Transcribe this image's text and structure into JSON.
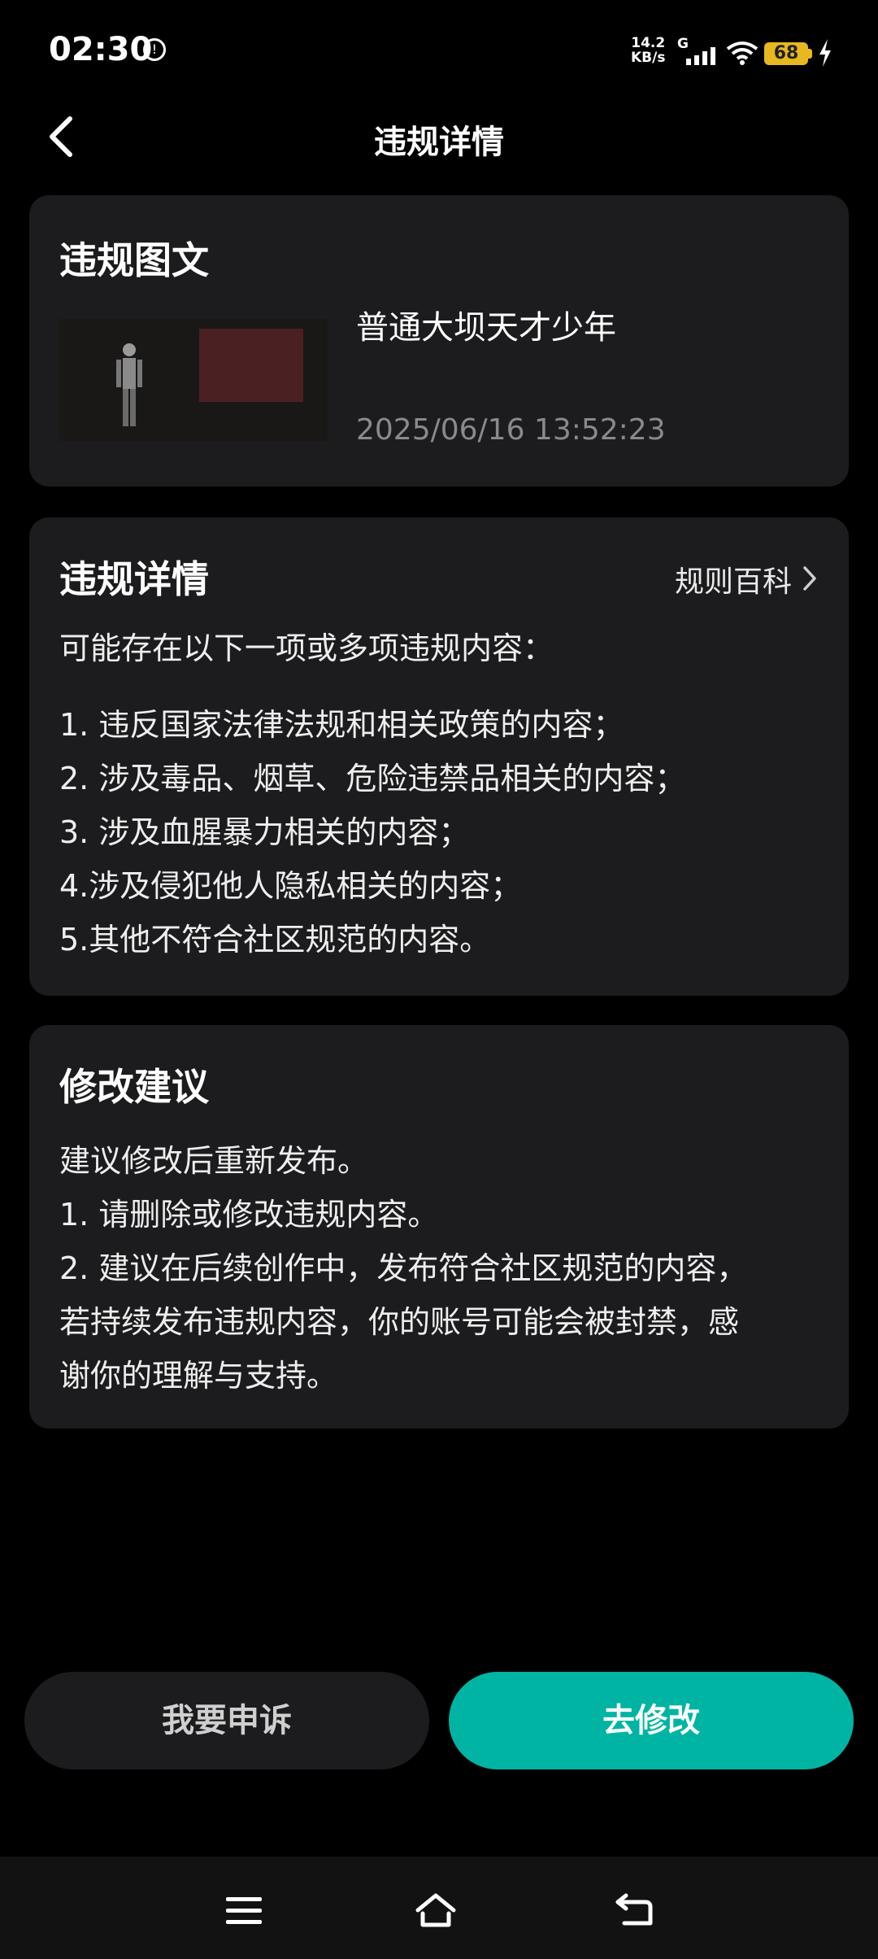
{
  "status_bar": {
    "time": "02:30",
    "net_speed_value": "14.2",
    "net_speed_unit": "KB/s",
    "network_type": "G",
    "battery": "68"
  },
  "header": {
    "title": "违规详情"
  },
  "content_card": {
    "heading": "违规图文",
    "post_title": "普通大坝天才少年",
    "post_time": "2025/06/16 13:52:23"
  },
  "violation_card": {
    "heading": "违规详情",
    "rules_link": "规则百科",
    "intro": "可能存在以下一项或多项违规内容：",
    "items": [
      "1. 违反国家法律法规和相关政策的内容；",
      "2. 涉及毒品、烟草、危险违禁品相关的内容；",
      "3. 涉及血腥暴力相关的内容；",
      "4.涉及侵犯他人隐私相关的内容；",
      "5.其他不符合社区规范的内容。"
    ]
  },
  "advice_card": {
    "heading": "修改建议",
    "lines": [
      "建议修改后重新发布。",
      "1. 请删除或修改违规内容。",
      "2. 建议在后续创作中，发布符合社区规范的内容，",
      "若持续发布违规内容，你的账号可能会被封禁，感",
      "谢你的理解与支持。"
    ]
  },
  "actions": {
    "appeal": "我要申诉",
    "edit": "去修改"
  },
  "colors": {
    "accent": "#00b4a3",
    "card": "#1c1c1e",
    "battery": "#e8b820"
  }
}
